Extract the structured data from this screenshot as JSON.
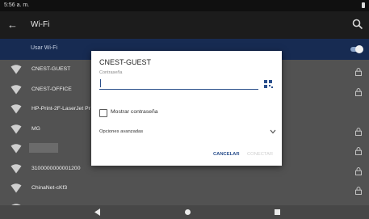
{
  "status_bar": {
    "time": "5:56 a. m."
  },
  "app_bar": {
    "title": "Wi-Fi",
    "back_icon": "←"
  },
  "wifi_toggle": {
    "label": "Usar Wi-Fi",
    "on": true
  },
  "networks": [
    {
      "ssid": "CNEST-GUEST",
      "locked": true
    },
    {
      "ssid": "CNEST-OFFICE",
      "locked": true
    },
    {
      "ssid": "HP-Print-2F-LaserJet Pr",
      "locked": false
    },
    {
      "ssid": "MG",
      "locked": true
    },
    {
      "ssid": "",
      "locked": true,
      "blurred": true
    },
    {
      "ssid": "3100000000001200",
      "locked": true
    },
    {
      "ssid": "ChinaNet-cKf3",
      "locked": true
    },
    {
      "ssid": "ChinaNet-CV5n",
      "locked": true
    }
  ],
  "dialog": {
    "title": "CNEST-GUEST",
    "password_label": "Contraseña",
    "password_value": "",
    "show_password_label": "Mostrar contraseña",
    "show_password_checked": false,
    "advanced_label": "Opciones avanzadas",
    "cancel_label": "CANCELAR",
    "connect_label": "CONECTAR"
  },
  "colors": {
    "accent": "#2a4f8c",
    "selected_row": "#172b52",
    "background": "#525252"
  }
}
